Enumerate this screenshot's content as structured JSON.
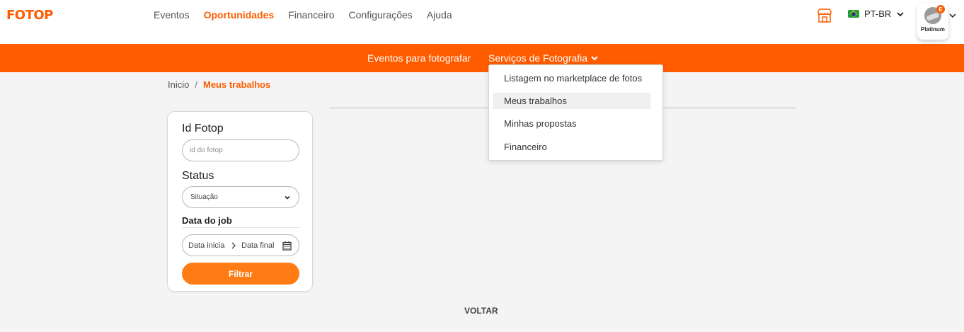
{
  "brand": {
    "logo": "FOTOP",
    "accent": "#ff5c00"
  },
  "nav": {
    "items": [
      {
        "label": "Eventos",
        "active": false
      },
      {
        "label": "Oportunidades",
        "active": true
      },
      {
        "label": "Financeiro",
        "active": false
      },
      {
        "label": "Configurações",
        "active": false
      },
      {
        "label": "Ajuda",
        "active": false
      }
    ]
  },
  "header": {
    "store_icon": "store-icon",
    "language": {
      "label": "PT-BR",
      "flag": "brazil-flag"
    },
    "user": {
      "badge": "E",
      "tier": "Platinum"
    }
  },
  "subnav": {
    "items": [
      "Eventos para fotografar",
      "Serviços de Fotografia"
    ],
    "dropdown": [
      "Listagem no marketplace de fotos",
      "Meus trabalhos",
      "Minhas propostas",
      "Financeiro"
    ],
    "highlighted": "Meus trabalhos"
  },
  "breadcrumb": {
    "home": "Inicio",
    "separator": "/",
    "current": "Meus trabalhos"
  },
  "filters": {
    "id_label": "Id Fotop",
    "id_placeholder": "id do fotop",
    "status_label": "Status",
    "status_value": "Situação",
    "date_label": "Data do job",
    "date_start": "Data inicia",
    "date_end": "Data final",
    "button": "Filtrar"
  },
  "footer": {
    "back": "VOLTAR"
  }
}
